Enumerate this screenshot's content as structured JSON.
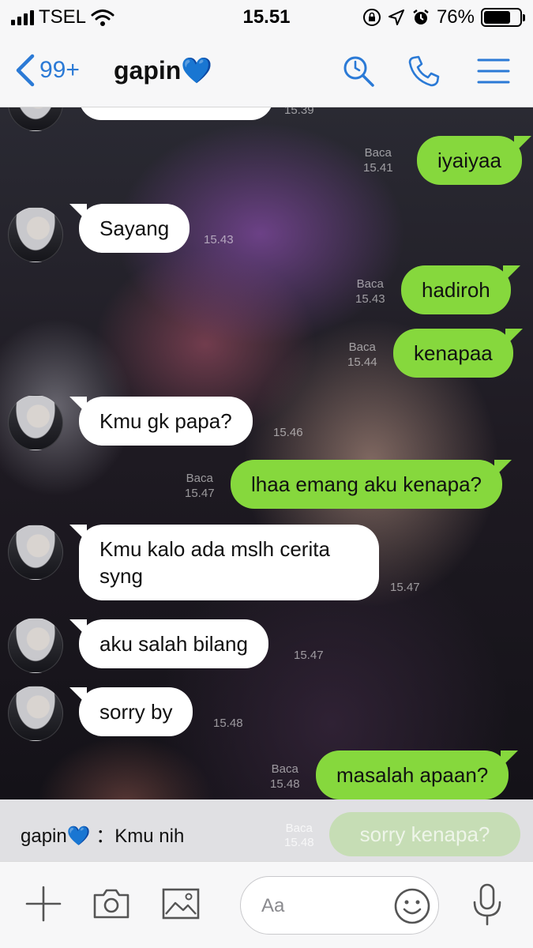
{
  "status_bar": {
    "carrier": "TSEL",
    "time": "15.51",
    "battery": "76%",
    "battery_level": 0.76
  },
  "header": {
    "unread_count": "99+",
    "chat_name": "gapin💙"
  },
  "messages": [
    {
      "side": "in",
      "text": "Sayang",
      "time": "15.43",
      "read": ""
    },
    {
      "side": "out",
      "text": "iyaiyaa",
      "time": "15.41",
      "read": "Baca"
    },
    {
      "side": "out",
      "text": "hadiroh",
      "time": "15.43",
      "read": "Baca"
    },
    {
      "side": "out",
      "text": "kenapaa",
      "time": "15.44",
      "read": "Baca"
    },
    {
      "side": "in",
      "text": "Kmu gk papa?",
      "time": "15.46",
      "read": ""
    },
    {
      "side": "out",
      "text": "lhaa emang aku kenapa?",
      "time": "15.47",
      "read": "Baca"
    },
    {
      "side": "in",
      "text": "Kmu kalo ada mslh cerita syng",
      "time": "15.47",
      "read": ""
    },
    {
      "side": "in",
      "text": "aku salah bilang",
      "time": "15.47",
      "read": ""
    },
    {
      "side": "in",
      "text": "sorry by",
      "time": "15.48",
      "read": ""
    },
    {
      "side": "out",
      "text": "masalah apaan?",
      "time": "15.48",
      "read": "Baca"
    }
  ],
  "partial_top_time": "15.39",
  "reply_preview": {
    "text": "gapin💙 ：Kmu nih",
    "ghost_message": "sorry kenapa?",
    "ghost_read": "Baca",
    "ghost_time": "15.48"
  },
  "input": {
    "placeholder": "Aa"
  },
  "icons": {
    "back": "chevron-left-icon",
    "search": "search-icon",
    "call": "phone-icon",
    "menu": "menu-icon",
    "add": "plus-icon",
    "camera": "camera-icon",
    "image": "image-icon",
    "emoji": "emoji-icon",
    "mic": "microphone-icon"
  },
  "colors": {
    "accent": "#2b7ad6",
    "outgoing_bubble": "#86d83d",
    "incoming_bubble": "#ffffff"
  }
}
